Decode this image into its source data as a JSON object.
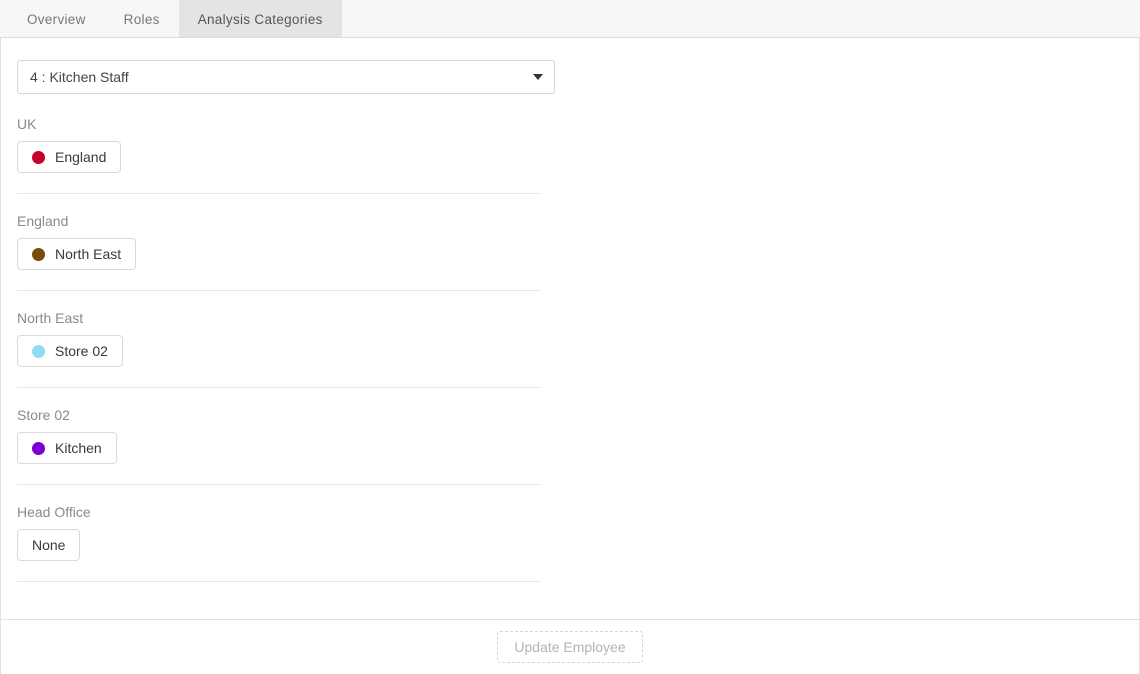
{
  "tabs": [
    {
      "label": "Overview",
      "active": false
    },
    {
      "label": "Roles",
      "active": false
    },
    {
      "label": "Analysis Categories",
      "active": true
    }
  ],
  "role_select": {
    "value": "4 : Kitchen Staff",
    "arrow_icon": "chevron-down-icon"
  },
  "groups": [
    {
      "label": "UK",
      "chip_label": "England",
      "chip_color": "#c8002d",
      "has_dot": true
    },
    {
      "label": "England",
      "chip_label": "North East",
      "chip_color": "#7a4a07",
      "has_dot": true
    },
    {
      "label": "North East",
      "chip_label": "Store 02",
      "chip_color": "#8fdcf0",
      "has_dot": true
    },
    {
      "label": "Store 02",
      "chip_label": "Kitchen",
      "chip_color": "#7a00d0",
      "has_dot": true
    },
    {
      "label": "Head Office",
      "chip_label": "None",
      "chip_color": "",
      "has_dot": false
    }
  ],
  "footer": {
    "update_label": "Update Employee",
    "update_disabled": true
  }
}
